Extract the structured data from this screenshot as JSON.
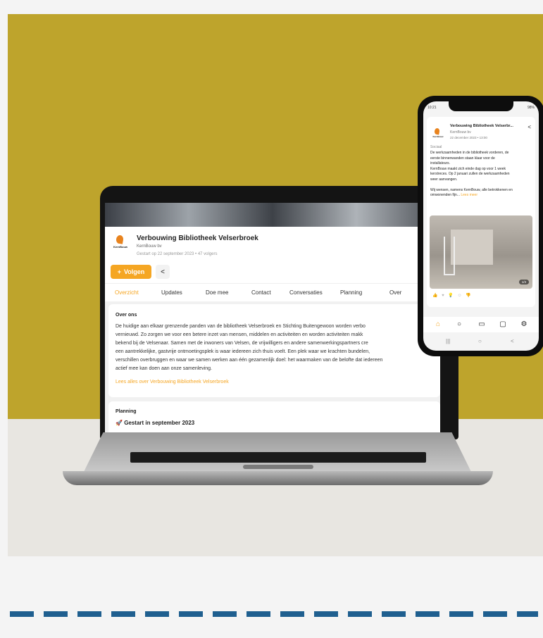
{
  "laptop": {
    "project_title": "Verbouwing Bibliotheek Velserbroek",
    "organization": "KernBouw bv",
    "meta": "Gestart op 22 september 2023 • 47 volgers",
    "logo_text": "KernBouw",
    "follow_label": "Volgen",
    "tabs": [
      "Overzicht",
      "Updates",
      "Doe mee",
      "Contact",
      "Conversaties",
      "Planning",
      "Over"
    ],
    "about": {
      "title": "Over ons",
      "lines": [
        "De huidige aan elkaar grenzende panden van de bibliotheek Velserbroek en Stichting Buitengewoon worden verbo",
        "vernieuwd. Zo zorgen we voor een betere inzet van mensen, middelen en activiteiten en worden activiteiten makk",
        "bekend bij de Velsenaar. Samen met de inwoners van Velsen, de vrijwilligers en andere samenwerkingspartners cre",
        "een aantrekkelijke, gastvrije ontmoetingsplek is waar iedereen zich thuis voelt. Een plek waar we krachten bundelen,",
        "verschillen overbruggen en waar we samen werken aan één gezamenlijk doel: het waarmaken van de belofte dat iedereen",
        "actief mee kan doen aan onze samenleving."
      ],
      "link": "Lees alles over Verbouwing Bibliotheek Velserbroek"
    },
    "planning": {
      "title": "Planning",
      "status": "Gestart in september 2023"
    }
  },
  "phone": {
    "status_time": "10:21",
    "status_battery": "98%",
    "post": {
      "title": "Verbouwing Bibliotheek Velserbr...",
      "organization": "KernBouw bv",
      "date": "22 december 2023 • 13:00",
      "logo_text": "KernBouw",
      "category": "Sociaal",
      "lines": [
        "De werkzaamheden in de bibliotheek vorderen, de",
        "eerste binnenwanden staan klaar voor de",
        "installateurs.",
        "KernBouw maakt zich einde dag op voor 1 week",
        "kerstreces. Op 2 januari zullen de werkzaamheden",
        "weer aanvangen.",
        "",
        "Wij wensen, namens KernBouw, alle betrokkenen en",
        "omwonenden fijn..."
      ],
      "read_more": "Lees meer",
      "image_counter": "1/3"
    }
  },
  "colors": {
    "background_top": "#bea42c",
    "accent": "#f5a623",
    "dashes": "#1f5f8f"
  }
}
